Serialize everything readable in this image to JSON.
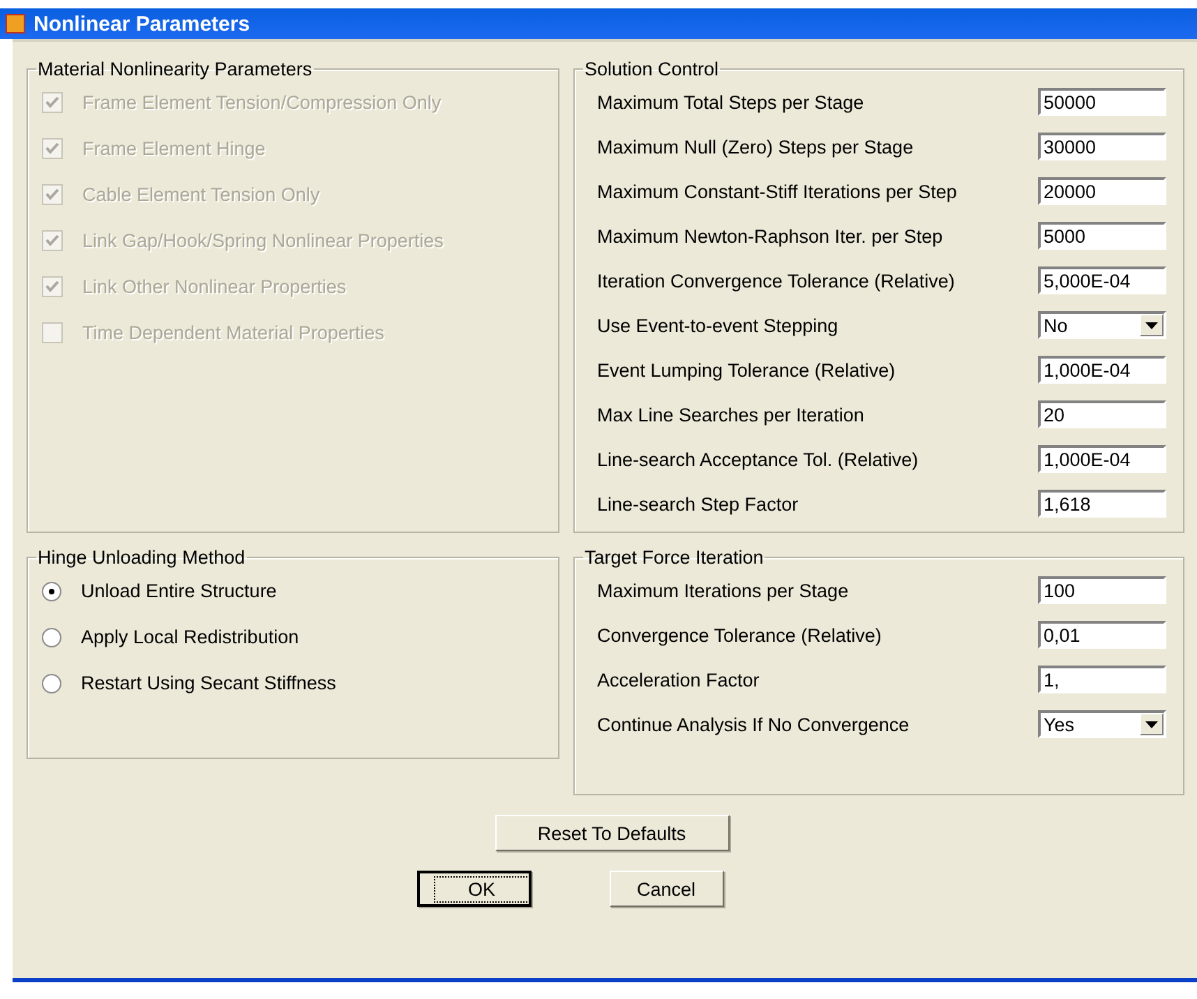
{
  "window": {
    "title": "Nonlinear Parameters"
  },
  "material_nonlinearity": {
    "title": "Material Nonlinearity Parameters",
    "options": [
      {
        "label": "Frame Element Tension/Compression Only",
        "checked": true,
        "disabled": true
      },
      {
        "label": "Frame Element Hinge",
        "checked": true,
        "disabled": true
      },
      {
        "label": "Cable Element Tension Only",
        "checked": true,
        "disabled": true
      },
      {
        "label": "Link Gap/Hook/Spring Nonlinear Properties",
        "checked": true,
        "disabled": true
      },
      {
        "label": "Link Other Nonlinear Properties",
        "checked": true,
        "disabled": true
      },
      {
        "label": "Time Dependent Material Properties",
        "checked": false,
        "disabled": true
      }
    ]
  },
  "solution_control": {
    "title": "Solution Control",
    "fields": [
      {
        "label": "Maximum Total Steps per Stage",
        "kind": "text",
        "value": "50000"
      },
      {
        "label": "Maximum Null (Zero) Steps per Stage",
        "kind": "text",
        "value": "30000"
      },
      {
        "label": "Maximum Constant-Stiff Iterations per Step",
        "kind": "text",
        "value": "20000"
      },
      {
        "label": "Maximum Newton-Raphson Iter. per Step",
        "kind": "text",
        "value": "5000"
      },
      {
        "label": "Iteration Convergence Tolerance (Relative)",
        "kind": "text",
        "value": "5,000E-04"
      },
      {
        "label": "Use Event-to-event Stepping",
        "kind": "combo",
        "value": "No"
      },
      {
        "label": "Event Lumping Tolerance (Relative)",
        "kind": "text",
        "value": "1,000E-04"
      },
      {
        "label": "Max Line Searches per Iteration",
        "kind": "text",
        "value": "20"
      },
      {
        "label": "Line-search Acceptance Tol. (Relative)",
        "kind": "text",
        "value": "1,000E-04"
      },
      {
        "label": "Line-search Step Factor",
        "kind": "text",
        "value": "1,618"
      }
    ]
  },
  "hinge_unloading": {
    "title": "Hinge Unloading Method",
    "options": [
      {
        "label": "Unload Entire Structure",
        "selected": true
      },
      {
        "label": "Apply Local Redistribution",
        "selected": false
      },
      {
        "label": "Restart Using Secant Stiffness",
        "selected": false
      }
    ]
  },
  "target_force_iteration": {
    "title": "Target Force Iteration",
    "fields": [
      {
        "label": "Maximum Iterations per Stage",
        "kind": "text",
        "value": "100"
      },
      {
        "label": "Convergence Tolerance (Relative)",
        "kind": "text",
        "value": "0,01"
      },
      {
        "label": "Acceleration Factor",
        "kind": "text",
        "value": "1,"
      },
      {
        "label": "Continue Analysis If No Convergence",
        "kind": "combo",
        "value": "Yes"
      }
    ]
  },
  "buttons": {
    "reset": "Reset To Defaults",
    "ok": "OK",
    "cancel": "Cancel"
  }
}
